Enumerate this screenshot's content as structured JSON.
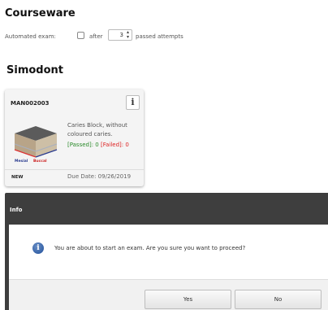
{
  "courseware": {
    "title": "Courseware",
    "automated_exam_label": "Automated exam:",
    "after_label": "after",
    "attempts_value": "3",
    "passed_attempts_label": "passed attempts"
  },
  "simodont": {
    "title": "Simodont",
    "card": {
      "code": "MAN002003",
      "info_icon_glyph": "i",
      "description": "Caries Block, without coloured caries.",
      "passed": "[Passed]: 0",
      "failed": "[Failed]: 0",
      "badge": "NEW",
      "due_date": "Due Date: 09/26/2019",
      "model_labels": {
        "mesial": "Mesial",
        "buccal": "Buccal"
      }
    }
  },
  "dialog": {
    "title": "Info",
    "info_icon_glyph": "i",
    "message": "You are about to start an exam. Are you sure you want to proceed?",
    "yes_label": "Yes",
    "no_label": "No"
  },
  "colors": {
    "dialog_header": "#3e3e3e",
    "passed": "#2a8a2a",
    "failed": "#dd2222"
  }
}
